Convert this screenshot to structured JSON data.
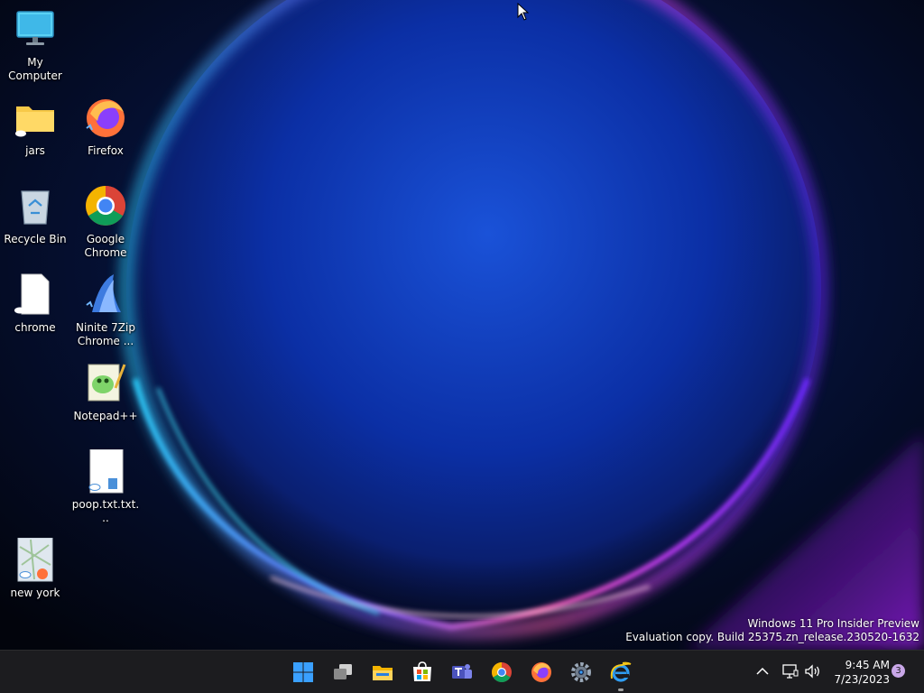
{
  "desktop": {
    "icons": [
      {
        "label": "My Computer",
        "icon": "monitor-icon"
      },
      {
        "label": "jars",
        "icon": "folder-icon"
      },
      {
        "label": "Firefox",
        "icon": "firefox-icon"
      },
      {
        "label": "Recycle Bin",
        "icon": "recycle-bin-icon"
      },
      {
        "label": "Google Chrome",
        "icon": "chrome-icon"
      },
      {
        "label": "chrome",
        "icon": "blank-file-icon"
      },
      {
        "label": "Ninite 7Zip Chrome ...",
        "icon": "ninite-icon"
      },
      {
        "label": "Notepad++",
        "icon": "notepadpp-icon"
      },
      {
        "label": "poop.txt.txt...",
        "icon": "text-file-icon"
      },
      {
        "label": "new york",
        "icon": "map-file-icon"
      }
    ],
    "watermark": {
      "line1": "Windows 11 Pro Insider Preview",
      "line2": "Evaluation copy. Build 25375.zn_release.230520-1632"
    }
  },
  "taskbar": {
    "apps": [
      {
        "name": "start",
        "icon": "windows-start-icon"
      },
      {
        "name": "task-view",
        "icon": "task-view-icon"
      },
      {
        "name": "file-explorer",
        "icon": "file-explorer-icon"
      },
      {
        "name": "microsoft-store",
        "icon": "store-icon"
      },
      {
        "name": "teams",
        "icon": "teams-icon"
      },
      {
        "name": "chrome",
        "icon": "chrome-icon"
      },
      {
        "name": "firefox",
        "icon": "firefox-icon"
      },
      {
        "name": "settings",
        "icon": "gear-icon"
      },
      {
        "name": "internet-explorer",
        "icon": "internet-explorer-icon",
        "active": true
      }
    ],
    "tray": {
      "time": "9:45 AM",
      "date": "7/23/2023",
      "notification_count": "3"
    }
  },
  "colors": {
    "taskbar_bg": "#1c1c1f",
    "bloom_blue": "#1e5ae0",
    "bloom_purple": "#a020f0",
    "bloom_pink": "#ff4fa0"
  }
}
